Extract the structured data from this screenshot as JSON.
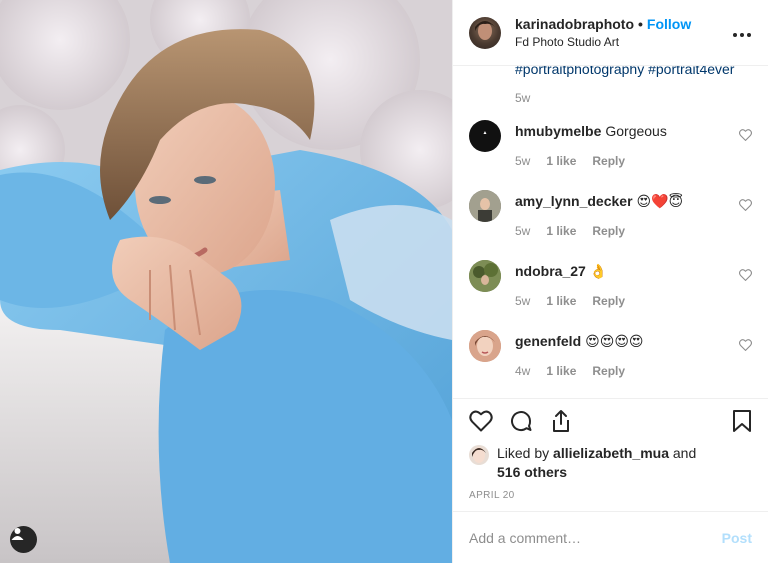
{
  "header": {
    "username": "karinadobraphoto",
    "separator": "•",
    "follow_label": "Follow",
    "location": "Fd Photo Studio Art",
    "more_label": "•••"
  },
  "caption": {
    "hashtags": "#portraitphotography #portrait4ever",
    "age": "5w"
  },
  "comments": [
    {
      "username": "hmubymelbe",
      "text": "Gorgeous",
      "age": "5w",
      "likes": "1 like",
      "reply": "Reply",
      "avatar_color": "#111111"
    },
    {
      "username": "amy_lynn_decker",
      "text": "😍❤️😇",
      "age": "5w",
      "likes": "1 like",
      "reply": "Reply",
      "avatar_color": "#6a6a62"
    },
    {
      "username": "ndobra_27",
      "text": "👌",
      "age": "5w",
      "likes": "1 like",
      "reply": "Reply",
      "avatar_color": "#5b6b3e"
    },
    {
      "username": "genenfeld",
      "text": "😍😍😍😍",
      "age": "4w",
      "likes": "1 like",
      "reply": "Reply",
      "avatar_color": "#c9927a"
    }
  ],
  "likes": {
    "prefix": "Liked by ",
    "user": "allielizabeth_mua",
    "middle": " and",
    "others": "516 others"
  },
  "date": "APRIL 20",
  "add_comment": {
    "placeholder": "Add a comment…",
    "post_label": "Post"
  },
  "icons": [
    "heart-icon",
    "comment-icon",
    "share-icon",
    "bookmark-icon",
    "user-tag-icon",
    "more-icon"
  ],
  "colors": {
    "accent": "#0095f6",
    "hashtag": "#00376b",
    "muted": "#8e8e8e",
    "post_disabled": "#b2dffc",
    "sweater": "#6fb4e3"
  }
}
